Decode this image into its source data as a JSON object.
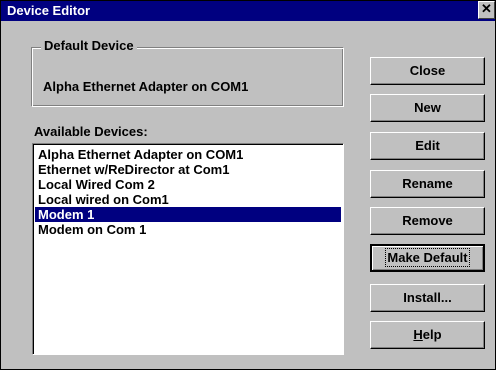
{
  "window": {
    "title": "Device Editor",
    "close_glyph": "✕"
  },
  "default_device": {
    "label": "Default Device",
    "value": "Alpha Ethernet Adapter on COM1"
  },
  "available_devices": {
    "label": "Available Devices:",
    "items": [
      "Alpha Ethernet Adapter on COM1",
      "Ethernet w/ReDirector at Com1",
      "Local Wired Com 2",
      "Local wired on Com1",
      "Modem 1",
      "Modem on Com 1"
    ],
    "selected_index": 4
  },
  "buttons": {
    "close": "Close",
    "new": "New",
    "edit": "Edit",
    "rename": "Rename",
    "remove": "Remove",
    "make_default": "Make Default",
    "install": "Install...",
    "help_mnemonic": "H",
    "help_rest": "elp"
  }
}
